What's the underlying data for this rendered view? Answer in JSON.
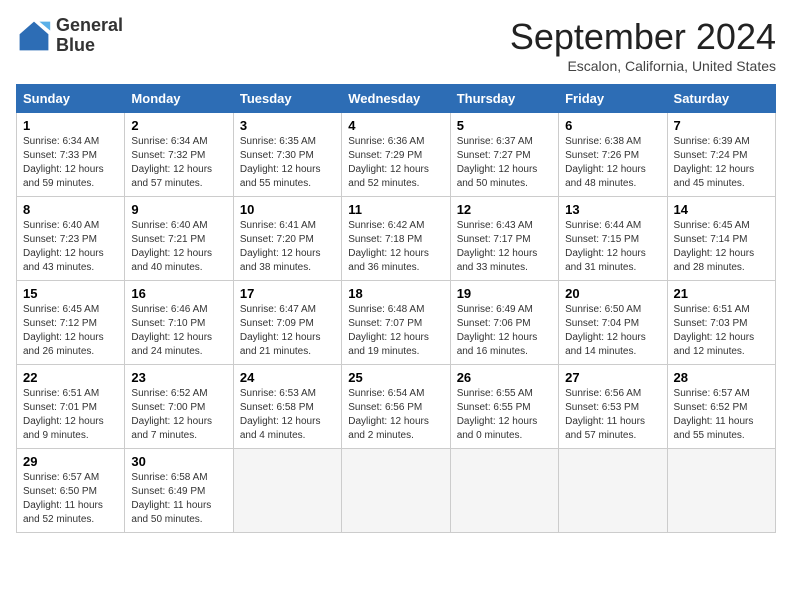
{
  "logo": {
    "line1": "General",
    "line2": "Blue"
  },
  "title": "September 2024",
  "subtitle": "Escalon, California, United States",
  "headers": [
    "Sunday",
    "Monday",
    "Tuesday",
    "Wednesday",
    "Thursday",
    "Friday",
    "Saturday"
  ],
  "weeks": [
    [
      {
        "day": "1",
        "sunrise": "6:34 AM",
        "sunset": "7:33 PM",
        "daylight": "12 hours and 59 minutes."
      },
      {
        "day": "2",
        "sunrise": "6:34 AM",
        "sunset": "7:32 PM",
        "daylight": "12 hours and 57 minutes."
      },
      {
        "day": "3",
        "sunrise": "6:35 AM",
        "sunset": "7:30 PM",
        "daylight": "12 hours and 55 minutes."
      },
      {
        "day": "4",
        "sunrise": "6:36 AM",
        "sunset": "7:29 PM",
        "daylight": "12 hours and 52 minutes."
      },
      {
        "day": "5",
        "sunrise": "6:37 AM",
        "sunset": "7:27 PM",
        "daylight": "12 hours and 50 minutes."
      },
      {
        "day": "6",
        "sunrise": "6:38 AM",
        "sunset": "7:26 PM",
        "daylight": "12 hours and 48 minutes."
      },
      {
        "day": "7",
        "sunrise": "6:39 AM",
        "sunset": "7:24 PM",
        "daylight": "12 hours and 45 minutes."
      }
    ],
    [
      {
        "day": "8",
        "sunrise": "6:40 AM",
        "sunset": "7:23 PM",
        "daylight": "12 hours and 43 minutes."
      },
      {
        "day": "9",
        "sunrise": "6:40 AM",
        "sunset": "7:21 PM",
        "daylight": "12 hours and 40 minutes."
      },
      {
        "day": "10",
        "sunrise": "6:41 AM",
        "sunset": "7:20 PM",
        "daylight": "12 hours and 38 minutes."
      },
      {
        "day": "11",
        "sunrise": "6:42 AM",
        "sunset": "7:18 PM",
        "daylight": "12 hours and 36 minutes."
      },
      {
        "day": "12",
        "sunrise": "6:43 AM",
        "sunset": "7:17 PM",
        "daylight": "12 hours and 33 minutes."
      },
      {
        "day": "13",
        "sunrise": "6:44 AM",
        "sunset": "7:15 PM",
        "daylight": "12 hours and 31 minutes."
      },
      {
        "day": "14",
        "sunrise": "6:45 AM",
        "sunset": "7:14 PM",
        "daylight": "12 hours and 28 minutes."
      }
    ],
    [
      {
        "day": "15",
        "sunrise": "6:45 AM",
        "sunset": "7:12 PM",
        "daylight": "12 hours and 26 minutes."
      },
      {
        "day": "16",
        "sunrise": "6:46 AM",
        "sunset": "7:10 PM",
        "daylight": "12 hours and 24 minutes."
      },
      {
        "day": "17",
        "sunrise": "6:47 AM",
        "sunset": "7:09 PM",
        "daylight": "12 hours and 21 minutes."
      },
      {
        "day": "18",
        "sunrise": "6:48 AM",
        "sunset": "7:07 PM",
        "daylight": "12 hours and 19 minutes."
      },
      {
        "day": "19",
        "sunrise": "6:49 AM",
        "sunset": "7:06 PM",
        "daylight": "12 hours and 16 minutes."
      },
      {
        "day": "20",
        "sunrise": "6:50 AM",
        "sunset": "7:04 PM",
        "daylight": "12 hours and 14 minutes."
      },
      {
        "day": "21",
        "sunrise": "6:51 AM",
        "sunset": "7:03 PM",
        "daylight": "12 hours and 12 minutes."
      }
    ],
    [
      {
        "day": "22",
        "sunrise": "6:51 AM",
        "sunset": "7:01 PM",
        "daylight": "12 hours and 9 minutes."
      },
      {
        "day": "23",
        "sunrise": "6:52 AM",
        "sunset": "7:00 PM",
        "daylight": "12 hours and 7 minutes."
      },
      {
        "day": "24",
        "sunrise": "6:53 AM",
        "sunset": "6:58 PM",
        "daylight": "12 hours and 4 minutes."
      },
      {
        "day": "25",
        "sunrise": "6:54 AM",
        "sunset": "6:56 PM",
        "daylight": "12 hours and 2 minutes."
      },
      {
        "day": "26",
        "sunrise": "6:55 AM",
        "sunset": "6:55 PM",
        "daylight": "12 hours and 0 minutes."
      },
      {
        "day": "27",
        "sunrise": "6:56 AM",
        "sunset": "6:53 PM",
        "daylight": "11 hours and 57 minutes."
      },
      {
        "day": "28",
        "sunrise": "6:57 AM",
        "sunset": "6:52 PM",
        "daylight": "11 hours and 55 minutes."
      }
    ],
    [
      {
        "day": "29",
        "sunrise": "6:57 AM",
        "sunset": "6:50 PM",
        "daylight": "11 hours and 52 minutes."
      },
      {
        "day": "30",
        "sunrise": "6:58 AM",
        "sunset": "6:49 PM",
        "daylight": "11 hours and 50 minutes."
      },
      null,
      null,
      null,
      null,
      null
    ]
  ]
}
